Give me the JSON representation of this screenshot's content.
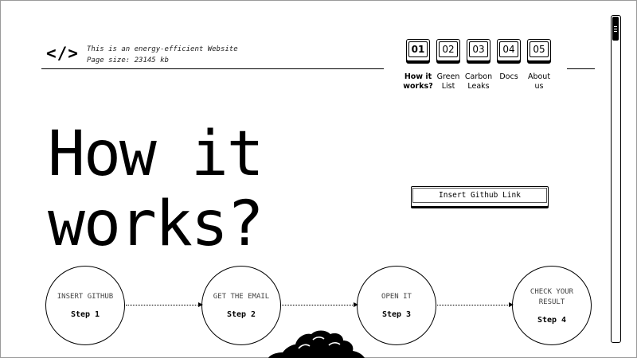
{
  "header": {
    "logo_text": "</>",
    "tagline_line1": "This is an energy-efficient Website",
    "tagline_line2": "Page size: 23145 kb"
  },
  "nav": {
    "items": [
      {
        "number": "01",
        "label": "How it\nworks?",
        "active": true
      },
      {
        "number": "02",
        "label": "Green\nList",
        "active": false
      },
      {
        "number": "03",
        "label": "Carbon\nLeaks",
        "active": false
      },
      {
        "number": "04",
        "label": "Docs",
        "active": false
      },
      {
        "number": "05",
        "label": "About\nus",
        "active": false
      }
    ]
  },
  "hero": {
    "title": "How it\nworks?",
    "github_button_label": "Insert Github Link"
  },
  "steps": [
    {
      "title": "INSERT GITHUB",
      "step": "Step 1"
    },
    {
      "title": "GET THE EMAIL",
      "step": "Step 2"
    },
    {
      "title": "OPEN IT",
      "step": "Step 3"
    },
    {
      "title": "CHECK YOUR\nRESULT",
      "step": "Step 4"
    }
  ],
  "icons": {
    "logo": "code-brackets-icon",
    "scroll_grip": "grip-lines-icon",
    "cloud": "cloud-icon"
  },
  "colors": {
    "background": "#ffffff",
    "foreground": "#000000"
  }
}
